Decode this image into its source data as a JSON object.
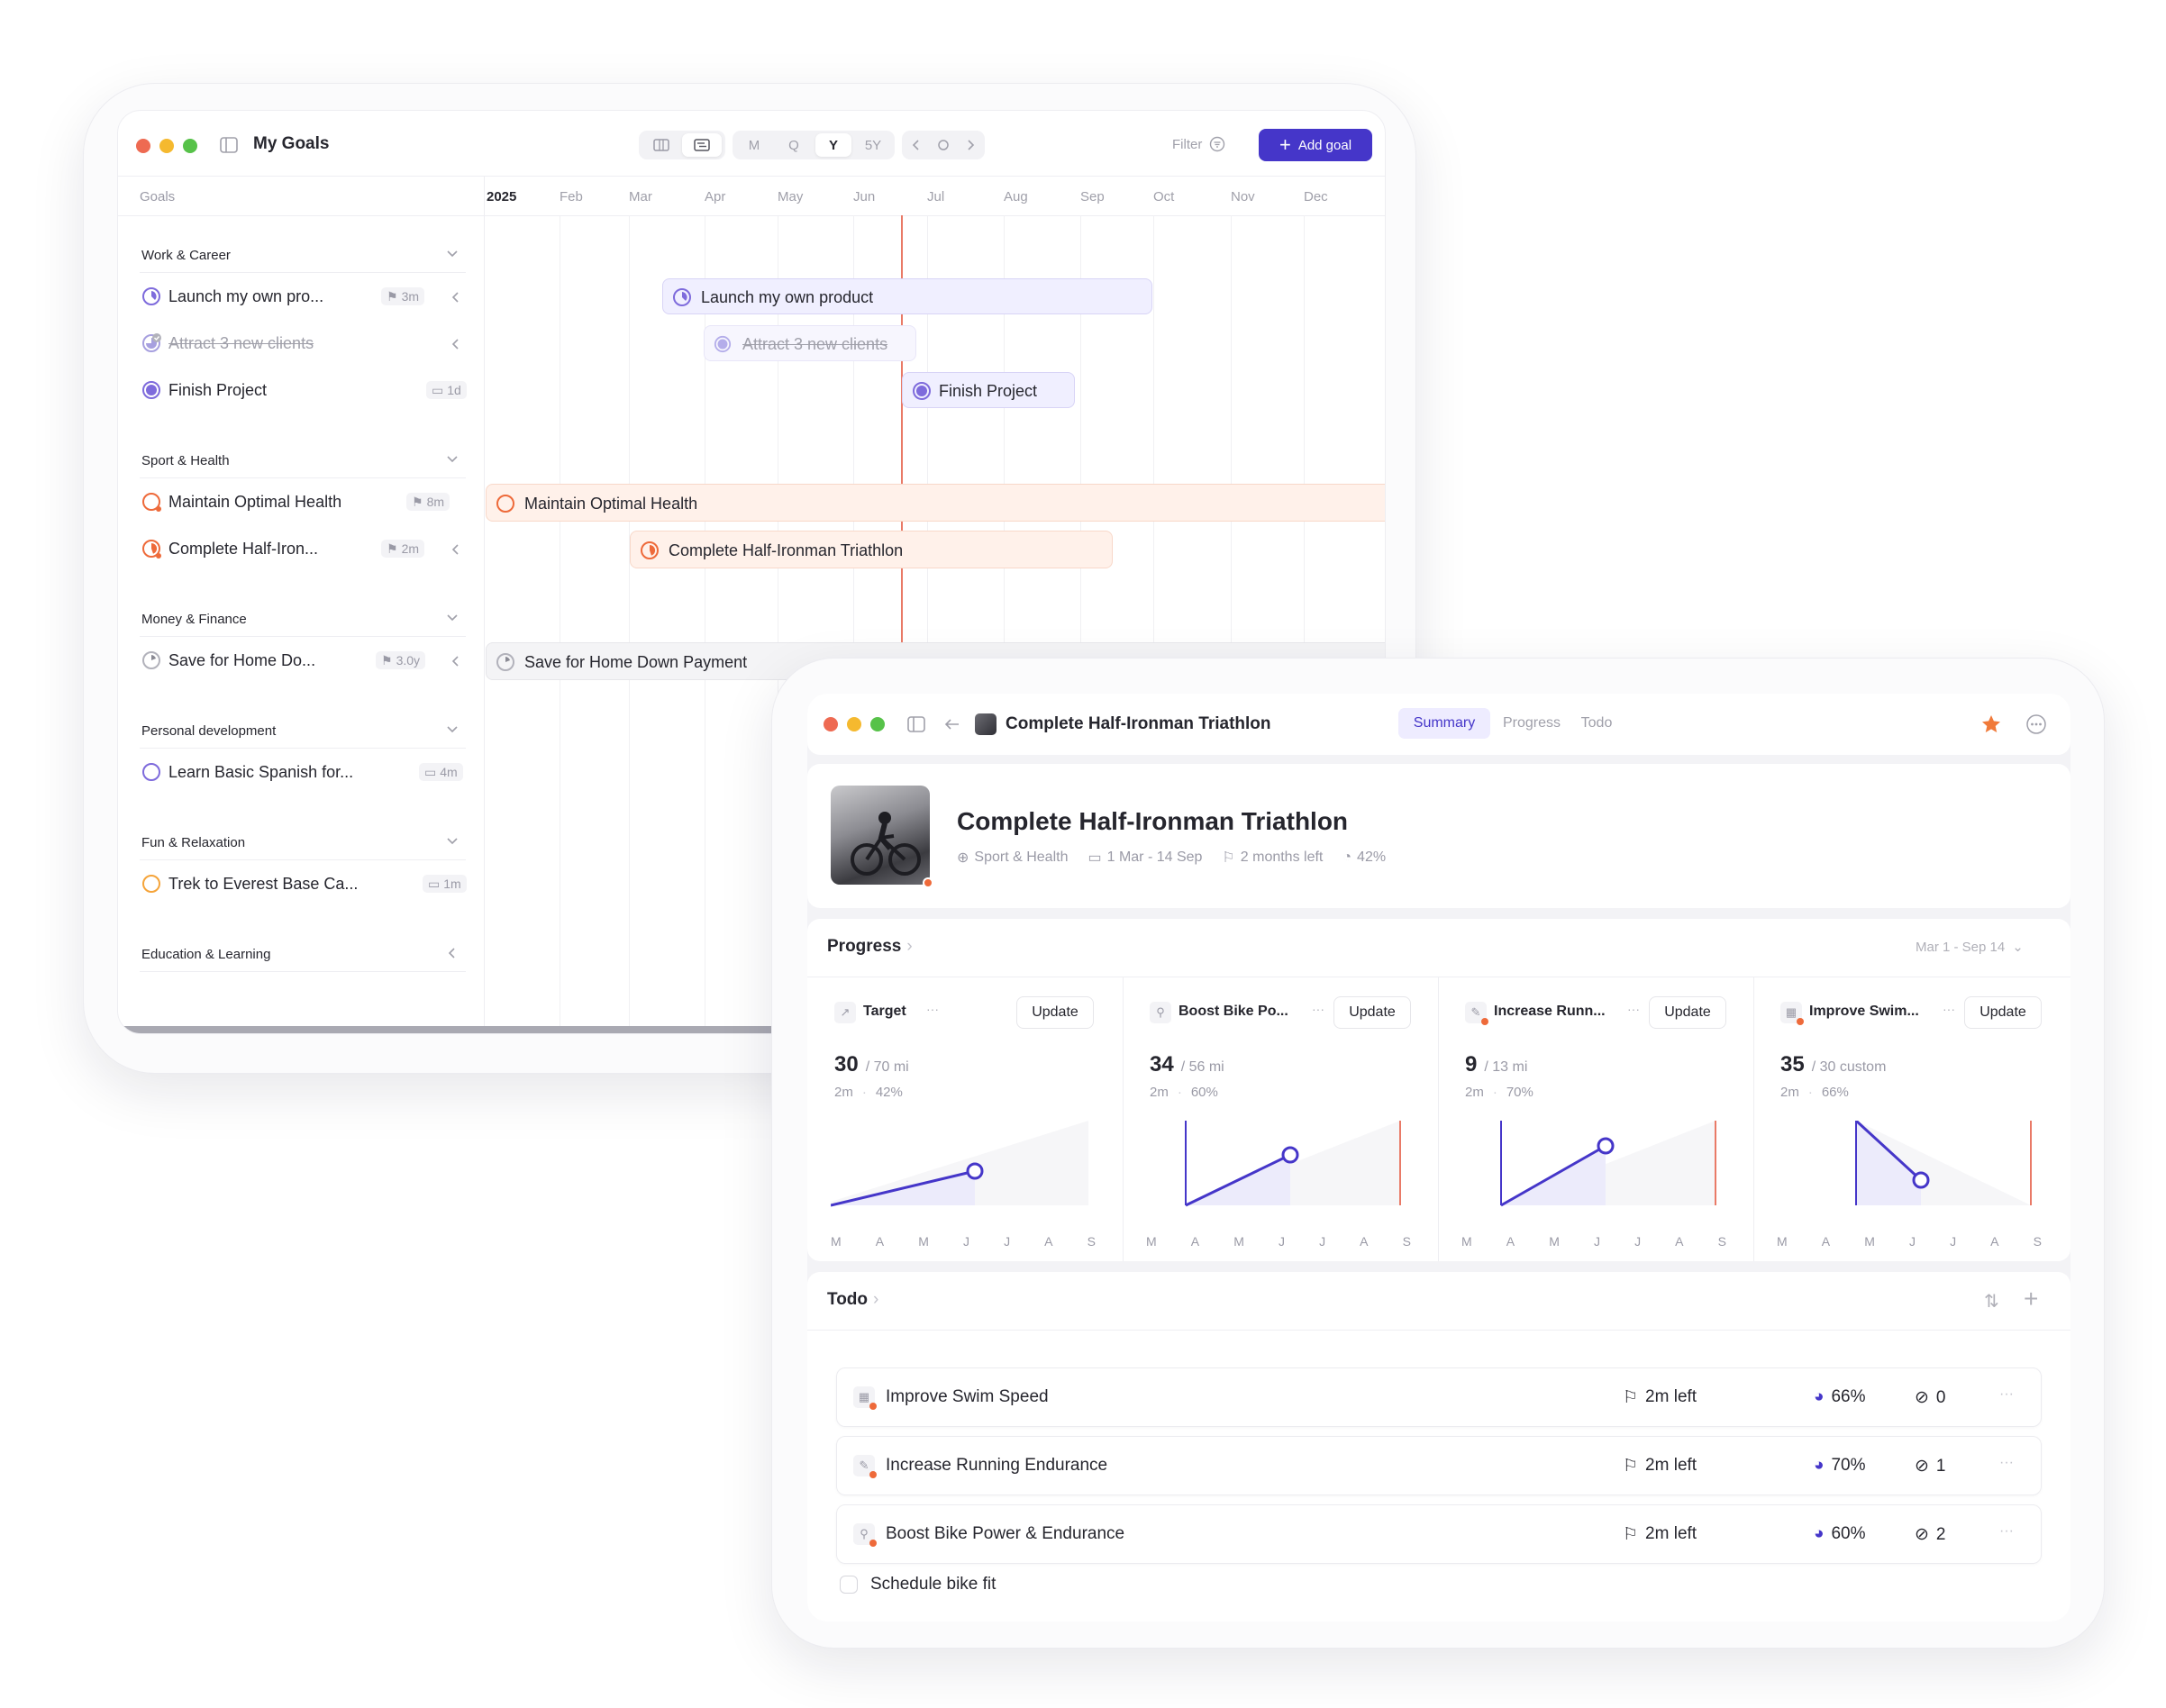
{
  "goals_window": {
    "title": "My Goals",
    "view_toggle": [
      "grid-icon",
      "calendar-icon"
    ],
    "periods": [
      "M",
      "Q",
      "Y",
      "5Y"
    ],
    "active_period": "Y",
    "filter_label": "Filter",
    "add_goal_label": "Add goal",
    "goals_header": "Goals",
    "months": [
      "2025",
      "Feb",
      "Mar",
      "Apr",
      "May",
      "Jun",
      "Jul",
      "Aug",
      "Sep",
      "Oct",
      "Nov",
      "Dec"
    ],
    "groups": [
      {
        "name": "Work & Career",
        "goals": [
          {
            "name": "Launch my own pro...",
            "badge": "3m"
          },
          {
            "name": "Attract 3 new clients",
            "badge": ""
          },
          {
            "name": "Finish Project",
            "badge": "1d"
          }
        ]
      },
      {
        "name": "Sport & Health",
        "goals": [
          {
            "name": "Maintain Optimal Health",
            "badge": "8m"
          },
          {
            "name": "Complete Half-Iron...",
            "badge": "2m"
          }
        ]
      },
      {
        "name": "Money & Finance",
        "goals": [
          {
            "name": "Save for Home Do...",
            "badge": "3.0y"
          }
        ]
      },
      {
        "name": "Personal development",
        "goals": [
          {
            "name": "Learn Basic Spanish for...",
            "badge": "4m"
          }
        ]
      },
      {
        "name": "Fun & Relaxation",
        "goals": [
          {
            "name": "Trek to Everest Base Ca...",
            "badge": "1m"
          }
        ]
      },
      {
        "name": "Education & Learning",
        "goals": []
      }
    ],
    "timeline_bars": [
      "Launch my own product",
      "Attract 3 new clients",
      "Finish Project",
      "Maintain Optimal Health",
      "Complete Half-Ironman Triathlon",
      "Save for Home Down Payment"
    ]
  },
  "detail_window": {
    "title": "Complete Half-Ironman Triathlon",
    "tabs": [
      "Summary",
      "Progress",
      "Todo"
    ],
    "active_tab": "Summary",
    "goal_title": "Complete Half-Ironman Triathlon",
    "meta": {
      "category": "Sport & Health",
      "dates": "1 Mar - 14 Sep",
      "time_left": "2 months left",
      "progress": "42%"
    },
    "progress_label": "Progress",
    "range_label": "Mar 1 - Sep 14",
    "update_label": "Update",
    "month_ticks": [
      "M",
      "A",
      "M",
      "J",
      "J",
      "A",
      "S"
    ],
    "cards": [
      {
        "name": "Target",
        "value": "30",
        "target": "/ 70 mi",
        "left": "2m",
        "pct": "42%",
        "icon": "chart-icon"
      },
      {
        "name": "Boost Bike Po...",
        "value": "34",
        "target": "/ 56 mi",
        "left": "2m",
        "pct": "60%",
        "icon": "bike-icon"
      },
      {
        "name": "Increase Runn...",
        "value": "9",
        "target": "/ 13 mi",
        "left": "2m",
        "pct": "70%",
        "icon": "run-icon"
      },
      {
        "name": "Improve Swim...",
        "value": "35",
        "target": "/ 30 custom",
        "left": "2m",
        "pct": "66%",
        "icon": "swim-icon"
      }
    ],
    "todo_label": "Todo",
    "todos": [
      {
        "name": "Improve Swim Speed",
        "left": "2m left",
        "pct": "66%",
        "count": "0"
      },
      {
        "name": "Increase Running Endurance",
        "left": "2m left",
        "pct": "70%",
        "count": "1"
      },
      {
        "name": "Boost Bike Power & Endurance",
        "left": "2m left",
        "pct": "60%",
        "count": "2"
      }
    ],
    "task": "Schedule bike fit"
  },
  "colors": {
    "accent": "#4536c9",
    "orange": "#ee6a3a",
    "purple": "#7e6bdc",
    "today_line": "#e97a67"
  }
}
